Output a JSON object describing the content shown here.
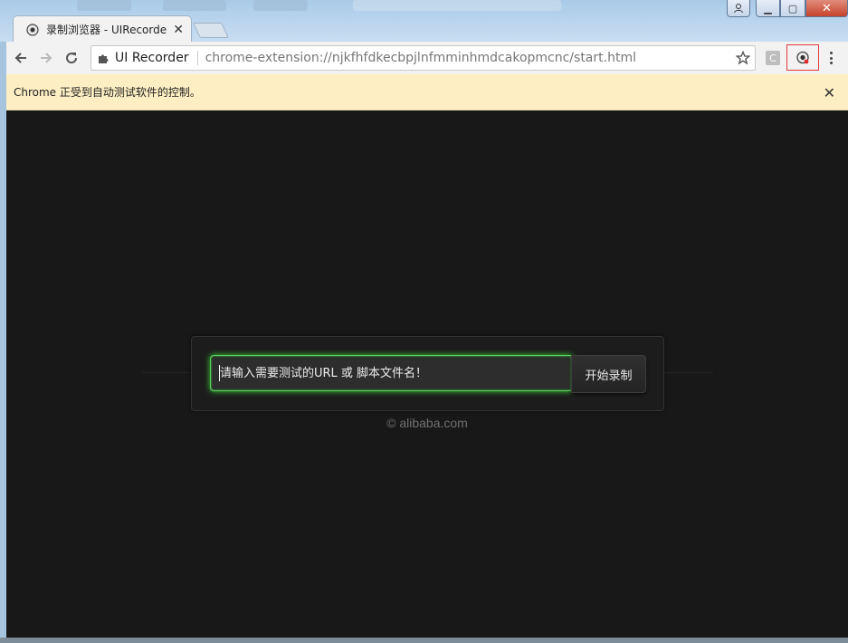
{
  "window": {
    "tab_title": "录制浏览器 - UIRecorde",
    "tab_close": "✕",
    "new_tab_label": "",
    "controls": {
      "minimize": "▁",
      "restore": "▢",
      "close": "✕"
    }
  },
  "toolbar": {
    "back_icon": "arrow-left",
    "forward_icon": "arrow-right",
    "reload_icon": "reload",
    "extension_name": "UI Recorder",
    "url": "chrome-extension://njkfhfdkecbpjlnfmminhmdcakopmcnc/start.html",
    "ext_c_label": "C"
  },
  "infobar": {
    "message": "Chrome 正受到自动测试软件的控制。",
    "close": "✕"
  },
  "main": {
    "input_placeholder": "请输入需要测试的URL 或 脚本文件名！",
    "start_button": "开始录制",
    "copyright": "© alibaba.com"
  },
  "colors": {
    "accent_glow": "#3ad23a",
    "page_bg": "#181818",
    "infobar_bg": "#fdefc3"
  }
}
